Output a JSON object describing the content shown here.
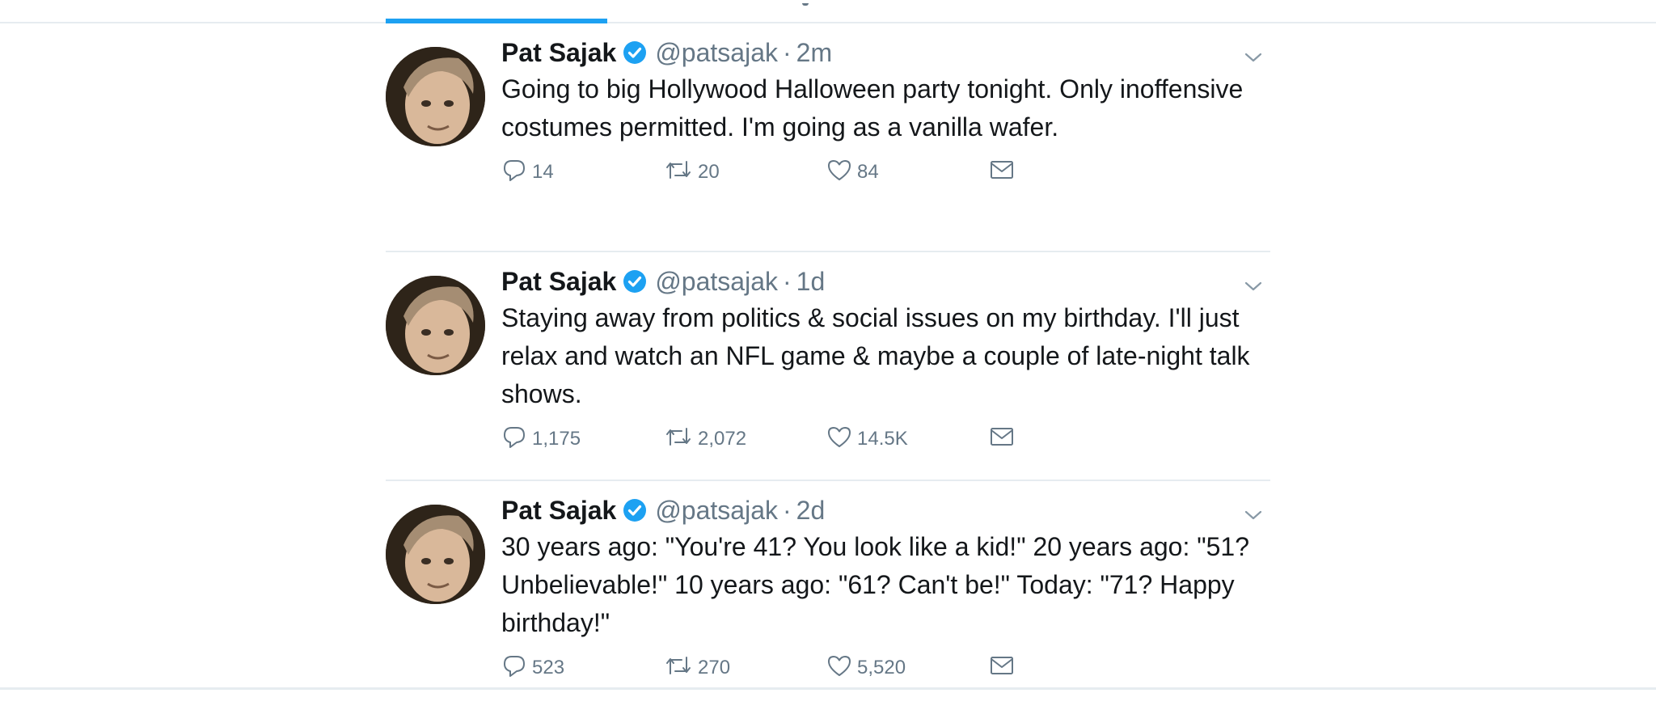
{
  "tweets": [
    {
      "author": "Pat Sajak",
      "handle": "@patsajak",
      "separator": "·",
      "time": "2m",
      "text": "Going to big Hollywood Halloween party tonight. Only inoffensive costumes permitted. I'm going as a vanilla wafer.",
      "replies": "14",
      "retweets": "20",
      "likes": "84"
    },
    {
      "author": "Pat Sajak",
      "handle": "@patsajak",
      "separator": "·",
      "time": "1d",
      "text": "Staying away from politics & social issues on my birthday. I'll just relax and watch an NFL game & maybe a couple of late-night talk shows.",
      "replies": "1,175",
      "retweets": "2,072",
      "likes": "14.5K"
    },
    {
      "author": "Pat Sajak",
      "handle": "@patsajak",
      "separator": "·",
      "time": "2d",
      "text": "30 years ago: \"You're 41? You look like a kid!\" 20 years ago: \"51? Unbelievable!\" 10 years ago: \"61? Can't be!\" Today: \"71? Happy birthday!\"",
      "replies": "523",
      "retweets": "270",
      "likes": "5,520"
    }
  ],
  "icons": {
    "verified": "verified-badge-icon",
    "reply": "reply-icon",
    "retweet": "retweet-icon",
    "like": "heart-icon",
    "message": "envelope-icon",
    "menu": "chevron-down-icon"
  },
  "colors": {
    "accent": "#1da1f2",
    "text": "#14171a",
    "secondary": "#657786",
    "divider": "#e6ecf0"
  }
}
